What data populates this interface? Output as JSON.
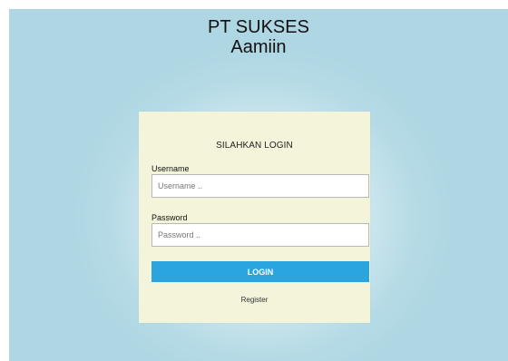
{
  "header": {
    "line1": "PT SUKSES",
    "line2": "Aamiin"
  },
  "login_card": {
    "title": "SILAHKAN LOGIN",
    "username_label": "Username",
    "username_placeholder": "Username ..",
    "username_value": "",
    "password_label": "Password",
    "password_placeholder": "Password ..",
    "password_value": "",
    "login_button": "LOGIN",
    "register_link": "Register"
  },
  "colors": {
    "background": "#aed7e3",
    "card": "#f4f4da",
    "button": "#2aa5e0",
    "button_text": "#ffffff"
  }
}
